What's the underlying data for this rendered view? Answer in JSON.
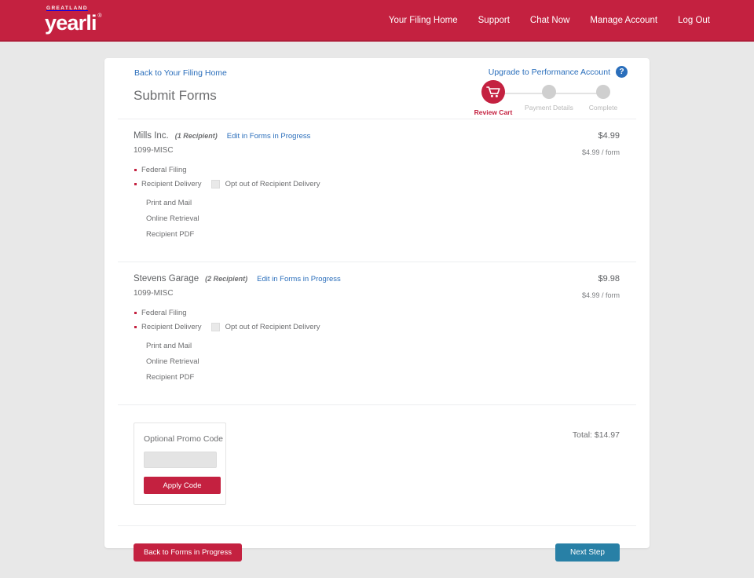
{
  "header": {
    "logo_top": "GREATLAND",
    "logo_word": "yearli",
    "logo_tm": "®",
    "nav": [
      {
        "label": "Your Filing Home"
      },
      {
        "label": "Support"
      },
      {
        "label": "Chat Now"
      },
      {
        "label": "Manage Account"
      },
      {
        "label": "Log Out"
      }
    ],
    "brand_color": "#c42140"
  },
  "card": {
    "back_link": "Back to Your Filing Home",
    "title": "Submit Forms",
    "upgrade_link": "Upgrade to Performance Account",
    "help_badge": "?",
    "stepper": [
      {
        "label": "Review Cart",
        "state": "active",
        "icon": "shopping-cart-icon"
      },
      {
        "label": "Payment Details",
        "state": "inactive",
        "icon": "step-dot-icon"
      },
      {
        "label": "Complete",
        "state": "inactive",
        "icon": "step-dot-icon"
      }
    ]
  },
  "items": [
    {
      "name": "Mills Inc.",
      "recipients": "(1 Recipient)",
      "edit_link": "Edit in Forms in Progress",
      "form_type": "1099-MISC",
      "price": "$4.99",
      "unit_price": "$4.99 / form",
      "bullets": [
        {
          "label": "Federal Filing"
        },
        {
          "label": "Recipient Delivery"
        }
      ],
      "optout_label": "Opt out of Recipient Delivery",
      "optout_checked": false,
      "sub_items": [
        "Print and Mail",
        "Online Retrieval",
        "Recipient PDF"
      ]
    },
    {
      "name": "Stevens Garage",
      "recipients": "(2 Recipient)",
      "edit_link": "Edit in Forms in Progress",
      "form_type": "1099-MISC",
      "price": "$9.98",
      "unit_price": "$4.99 / form",
      "bullets": [
        {
          "label": "Federal Filing"
        },
        {
          "label": "Recipient Delivery"
        }
      ],
      "optout_label": "Opt out of Recipient Delivery",
      "optout_checked": false,
      "sub_items": [
        "Print and Mail",
        "Online Retrieval",
        "Recipient PDF"
      ]
    }
  ],
  "promo": {
    "label": "Optional Promo Code",
    "input_value": "",
    "input_placeholder": "",
    "apply_label": "Apply Code"
  },
  "total": {
    "text": "Total: $14.97"
  },
  "footer": {
    "back_label": "Back to Forms in Progress",
    "next_label": "Next Step"
  }
}
